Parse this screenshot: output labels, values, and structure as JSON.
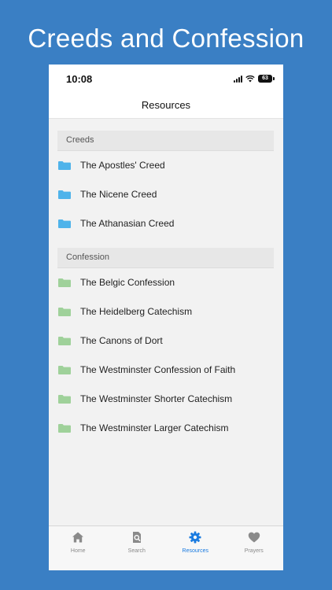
{
  "promo": {
    "title": "Creeds and Confession"
  },
  "status_bar": {
    "time": "10:08",
    "battery": "63"
  },
  "nav": {
    "title": "Resources"
  },
  "sections": [
    {
      "header": "Creeds",
      "folder_color": "#4fb3ea",
      "items": [
        "The Apostles' Creed",
        "The Nicene Creed",
        "The Athanasian Creed"
      ]
    },
    {
      "header": "Confession",
      "folder_color": "#9fd19a",
      "items": [
        "The Belgic Confession",
        "The Heidelberg Catechism",
        "The Canons of Dort",
        "The Westminster Confession of Faith",
        "The Westminster Shorter Catechism",
        "The Westminster Larger Catechism"
      ]
    }
  ],
  "tab_bar": {
    "active_color": "#1a7be0",
    "inactive_color": "#8a8a8a",
    "tabs": [
      {
        "label": "Home",
        "icon": "home-icon"
      },
      {
        "label": "Search",
        "icon": "search-document-icon"
      },
      {
        "label": "Resources",
        "icon": "gear-icon"
      },
      {
        "label": "Prayers",
        "icon": "heart-icon"
      }
    ]
  }
}
